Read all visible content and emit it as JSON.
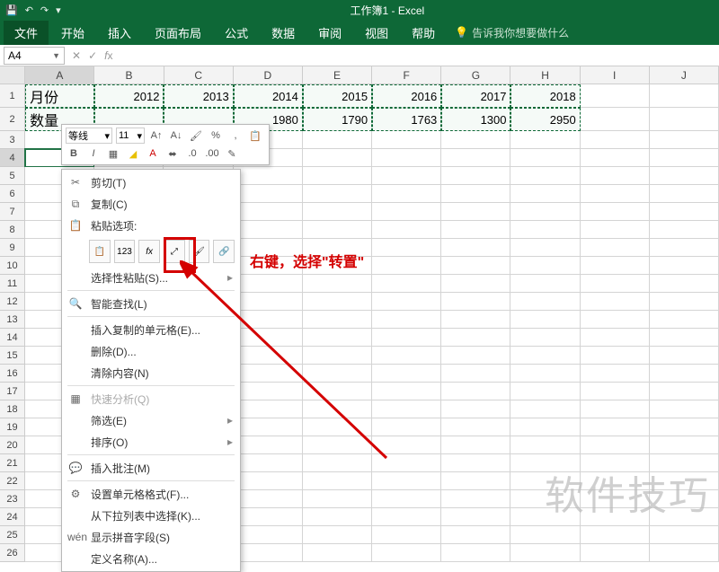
{
  "app": {
    "title": "工作簿1 - Excel"
  },
  "qat": {
    "save": "💾",
    "undo": "↶",
    "redo": "↷"
  },
  "tabs": {
    "file": "文件",
    "home": "开始",
    "insert": "插入",
    "layout": "页面布局",
    "formula": "公式",
    "data": "数据",
    "review": "审阅",
    "view": "视图",
    "help": "帮助",
    "tellme": "告诉我你想要做什么"
  },
  "namebox": {
    "ref": "A4"
  },
  "columns": [
    "A",
    "B",
    "C",
    "D",
    "E",
    "F",
    "G",
    "H",
    "I",
    "J"
  ],
  "row_nums": [
    1,
    2,
    3,
    4,
    5,
    6,
    7,
    8,
    9,
    10,
    11,
    12,
    13,
    14,
    15,
    16,
    17,
    18,
    19,
    20,
    21,
    22,
    23,
    24,
    25,
    26
  ],
  "data_rows": [
    {
      "label": "月份",
      "vals": [
        "2012",
        "2013",
        "2014",
        "2015",
        "2016",
        "2017",
        "2018"
      ]
    },
    {
      "label": "数量",
      "vals": [
        "",
        "",
        "1980",
        "1790",
        "1763",
        "1300",
        "2950"
      ]
    }
  ],
  "mini": {
    "font": "等线",
    "size": "11"
  },
  "ctx": {
    "cut": "剪切(T)",
    "copy": "复制(C)",
    "paste_opts": "粘贴选项:",
    "paste_special": "选择性粘贴(S)...",
    "smart_lookup": "智能查找(L)",
    "insert_copied": "插入复制的单元格(E)...",
    "delete": "删除(D)...",
    "clear": "清除内容(N)",
    "quick_analysis": "快速分析(Q)",
    "filter": "筛选(E)",
    "sort": "排序(O)",
    "insert_comment": "插入批注(M)",
    "format_cells": "设置单元格格式(F)...",
    "pick_list": "从下拉列表中选择(K)...",
    "show_phonetic": "显示拼音字段(S)",
    "define_name": "定义名称(A)..."
  },
  "annotation": "右键，选择\"转置\"",
  "watermark": "软件技巧"
}
